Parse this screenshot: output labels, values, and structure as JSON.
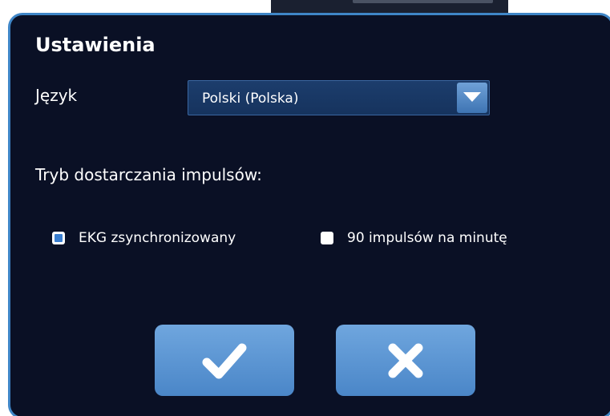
{
  "settings": {
    "title": "Ustawienia",
    "language_label": "Język",
    "language_value": "Polski (Polska)",
    "pulse_mode_label": "Tryb dostarczania impulsów:",
    "options": [
      {
        "label": "EKG zsynchronizowany",
        "checked": true
      },
      {
        "label": "90 impulsów na minutę",
        "checked": false
      }
    ]
  },
  "buttons": {
    "confirm_icon": "checkmark-icon",
    "cancel_icon": "x-icon"
  },
  "colors": {
    "dialog_background": "#0a1025",
    "dialog_border": "#3f86c7",
    "button": "#5c96d2",
    "select_background": "#1a3a66"
  }
}
